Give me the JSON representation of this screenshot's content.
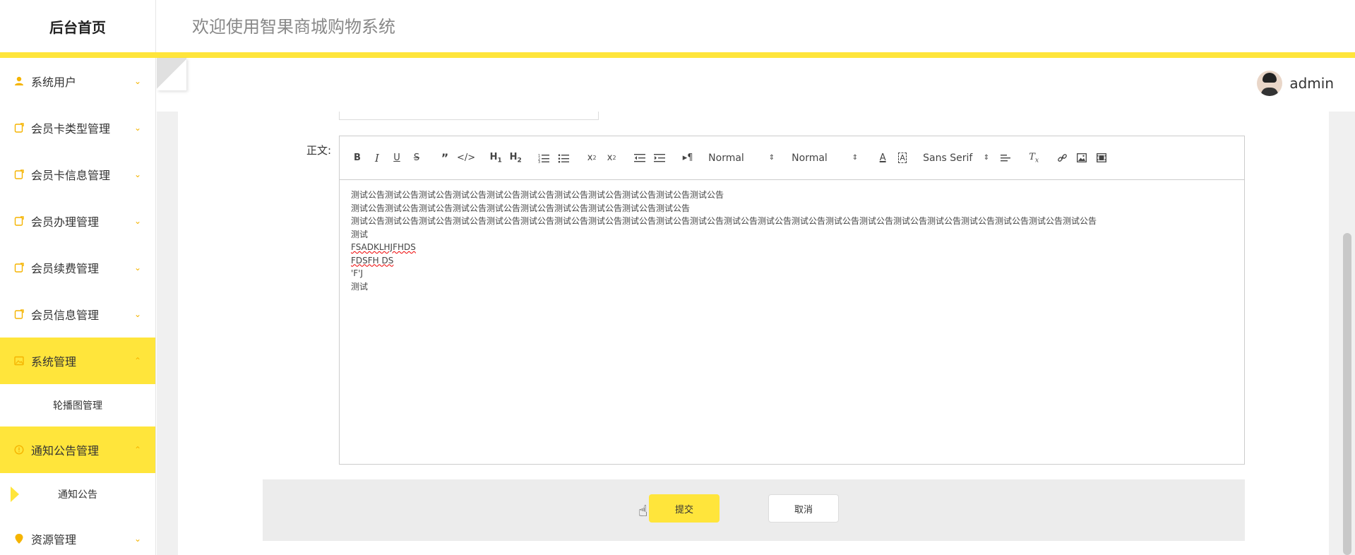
{
  "header": {
    "brand": "后台首页",
    "welcome": "欢迎使用智果商城购物系统"
  },
  "sidebar": {
    "items": [
      {
        "label": "系统用户",
        "icon": "user-icon",
        "active": false
      },
      {
        "label": "会员卡类型管理",
        "icon": "doc-icon",
        "active": false
      },
      {
        "label": "会员卡信息管理",
        "icon": "doc-icon",
        "active": false
      },
      {
        "label": "会员办理管理",
        "icon": "doc-icon",
        "active": false
      },
      {
        "label": "会员续费管理",
        "icon": "doc-icon",
        "active": false
      },
      {
        "label": "会员信息管理",
        "icon": "doc-icon",
        "active": false
      },
      {
        "label": "系统管理",
        "icon": "image-icon",
        "active": true
      },
      {
        "label": "轮播图管理"
      },
      {
        "label": "通知公告管理",
        "icon": "info-icon",
        "active": true
      },
      {
        "label": "通知公告"
      },
      {
        "label": "资源管理",
        "icon": "location-icon",
        "active": false
      }
    ]
  },
  "topbar": {
    "username": "admin"
  },
  "form": {
    "body_label": "正文:",
    "toolbar": {
      "header_select": "Normal",
      "size_select": "Normal",
      "font_select": "Sans Serif"
    },
    "content_lines": [
      "测试公告测试公告测试公告测试公告测试公告测试公告测试公告测试公告测试公告测试公告测试公告",
      "测试公告测试公告测试公告测试公告测试公告测试公告测试公告测试公告测试公告测试公告",
      "测试公告测试公告测试公告测试公告测试公告测试公告测试公告测试公告测试公告测试公告测试公告测试公告测试公告测试公告测试公告测试公告测试公告测试公告测试公告测试公告测试公告测试公告",
      "测试",
      "FSADKLHJFHDS",
      "FDSFH DS",
      "'F'J",
      "测试"
    ],
    "submit_label": "提交",
    "cancel_label": "取消"
  },
  "colors": {
    "accent": "#ffe53b",
    "icon": "#f5b400"
  }
}
